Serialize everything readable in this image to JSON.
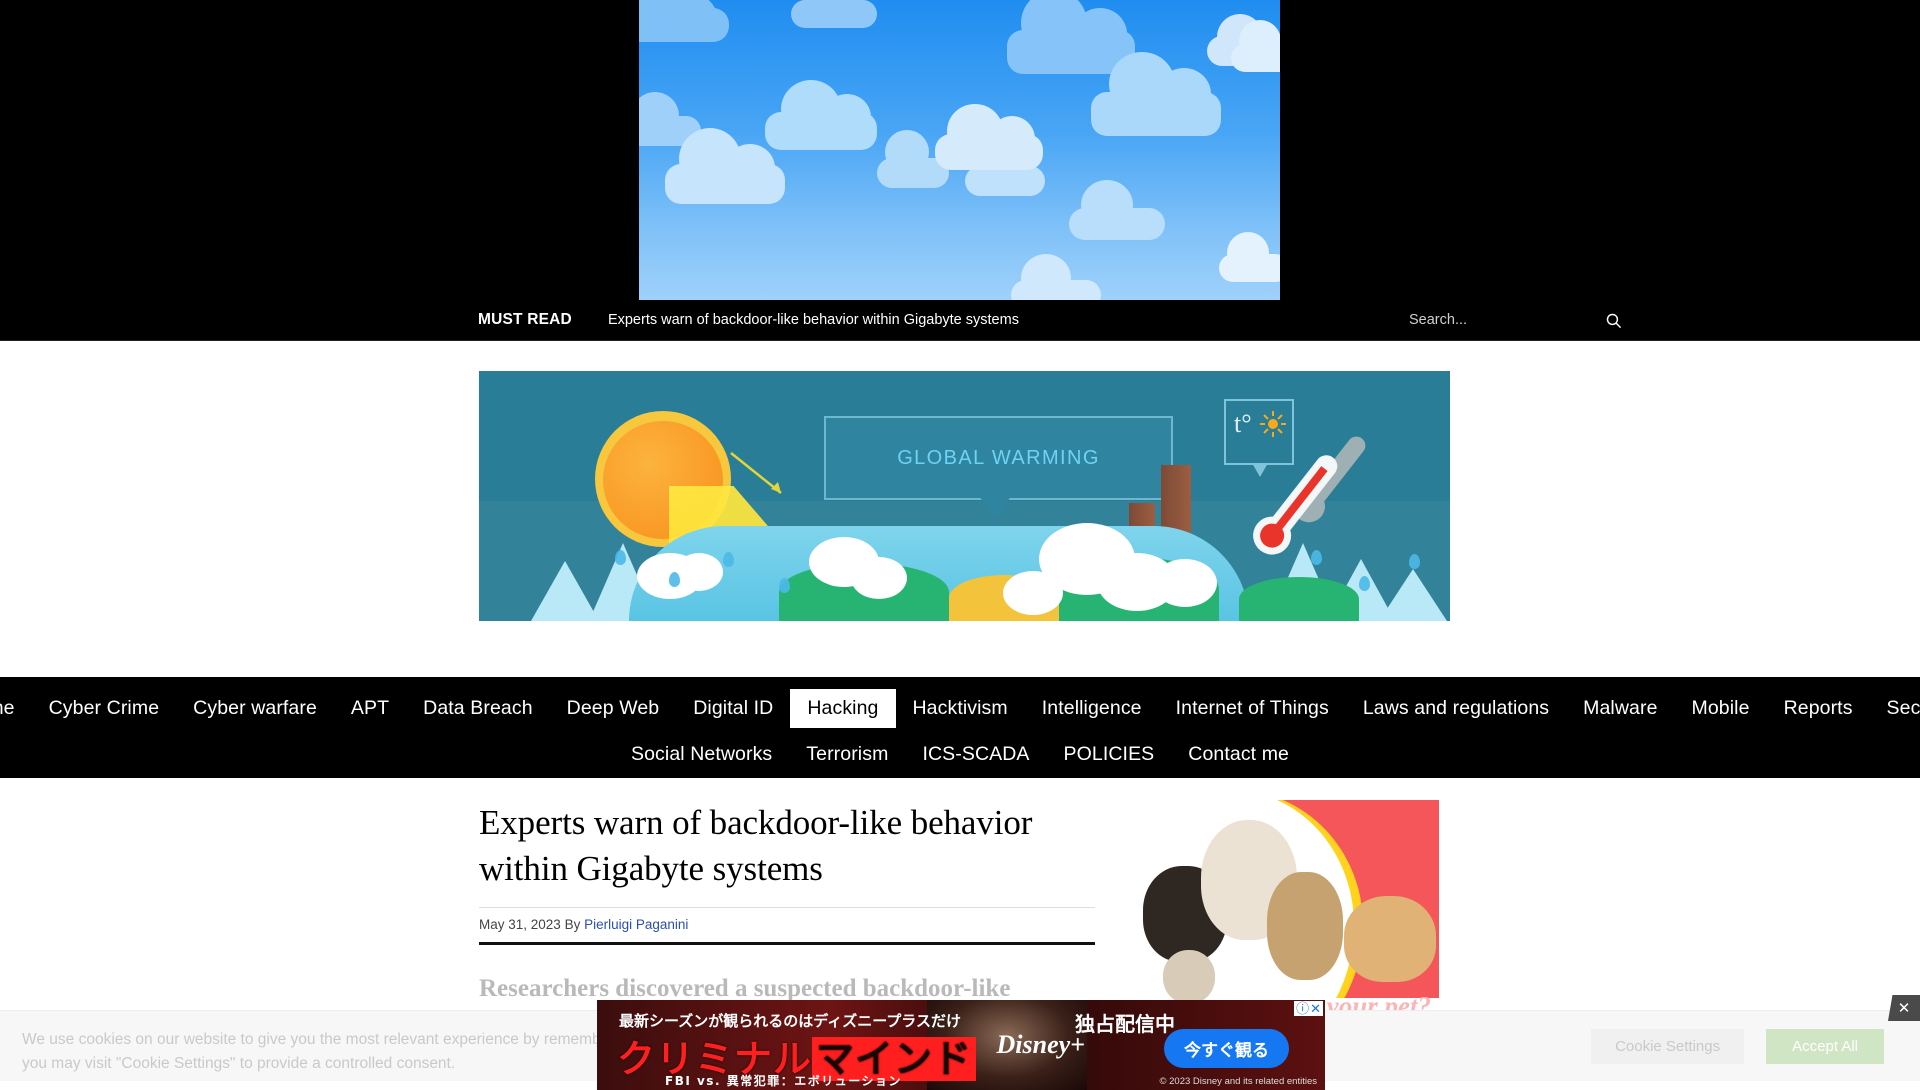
{
  "top_ad": {
    "name": "sky-clouds-leaderboard",
    "alt": "Blue sky with cartoon clouds advertisement"
  },
  "mustread": {
    "label": "MUST READ",
    "headline": "Experts warn of backdoor-like behavior within Gigabyte systems",
    "search_placeholder": "Search...",
    "search_value": "",
    "search_icon": "search-icon"
  },
  "hero_banner": {
    "title": "GLOBAL WARMING",
    "degree_symbol": "t°",
    "alt": "Global warming illustration with sun, thermometer, factory smokestacks and melting icebergs"
  },
  "nav": {
    "row1": [
      {
        "label": "Home",
        "active": false
      },
      {
        "label": "Cyber Crime",
        "active": false
      },
      {
        "label": "Cyber warfare",
        "active": false
      },
      {
        "label": "APT",
        "active": false
      },
      {
        "label": "Data Breach",
        "active": false
      },
      {
        "label": "Deep Web",
        "active": false
      },
      {
        "label": "Digital ID",
        "active": false
      },
      {
        "label": "Hacking",
        "active": true
      },
      {
        "label": "Hacktivism",
        "active": false
      },
      {
        "label": "Intelligence",
        "active": false
      },
      {
        "label": "Internet of Things",
        "active": false
      },
      {
        "label": "Laws and regulations",
        "active": false
      },
      {
        "label": "Malware",
        "active": false
      },
      {
        "label": "Mobile",
        "active": false
      },
      {
        "label": "Reports",
        "active": false
      },
      {
        "label": "Security",
        "active": false
      }
    ],
    "row2": [
      {
        "label": "Social Networks",
        "active": false
      },
      {
        "label": "Terrorism",
        "active": false
      },
      {
        "label": "ICS-SCADA",
        "active": false
      },
      {
        "label": "POLICIES",
        "active": false
      },
      {
        "label": "Contact me",
        "active": false
      }
    ]
  },
  "article": {
    "title": "Experts warn of backdoor-like behavior within Gigabyte systems",
    "date": "May 31, 2023",
    "by_label": "By",
    "author": "Pierluigi Paganini",
    "body_excerpt": "Researchers discovered a suspected backdoor-like behavior"
  },
  "sidebar_ad": {
    "name": "pet-insurance-ad",
    "text": "your pet?",
    "alt": "Dogs and a cat on a red background advertisement"
  },
  "sticky_ad": {
    "tagline": "最新シーズンが観られるのはディズニープラスだけ",
    "title_part1": "クリミナル",
    "title_part2": "マインド",
    "subtitle": "FBI vs. 異常犯罪：エボリューション",
    "exclusive": "独占配信中",
    "brand": "Disney+",
    "cta": "今すぐ観る",
    "copyright": "© 2023 Disney and its related entities",
    "adchoices_info_icon": "info-icon",
    "adchoices_close_icon": "close-icon",
    "close_icon": "close-icon"
  },
  "cookie": {
    "line1": "We use cookies on our website to give you the most relevant experience by remembering",
    "line2": "you may visit \"Cookie Settings\" to provide a controlled consent.",
    "settings_label": "Cookie Settings",
    "accept_label": "Accept All"
  },
  "colors": {
    "nav_bg": "#000000",
    "active_nav_bg": "#ffffff",
    "link_blue": "#2b4fb3",
    "accept_green": "#cfe5c4",
    "banner_teal": "#2a7d96",
    "ad_red": "#f4565a"
  }
}
